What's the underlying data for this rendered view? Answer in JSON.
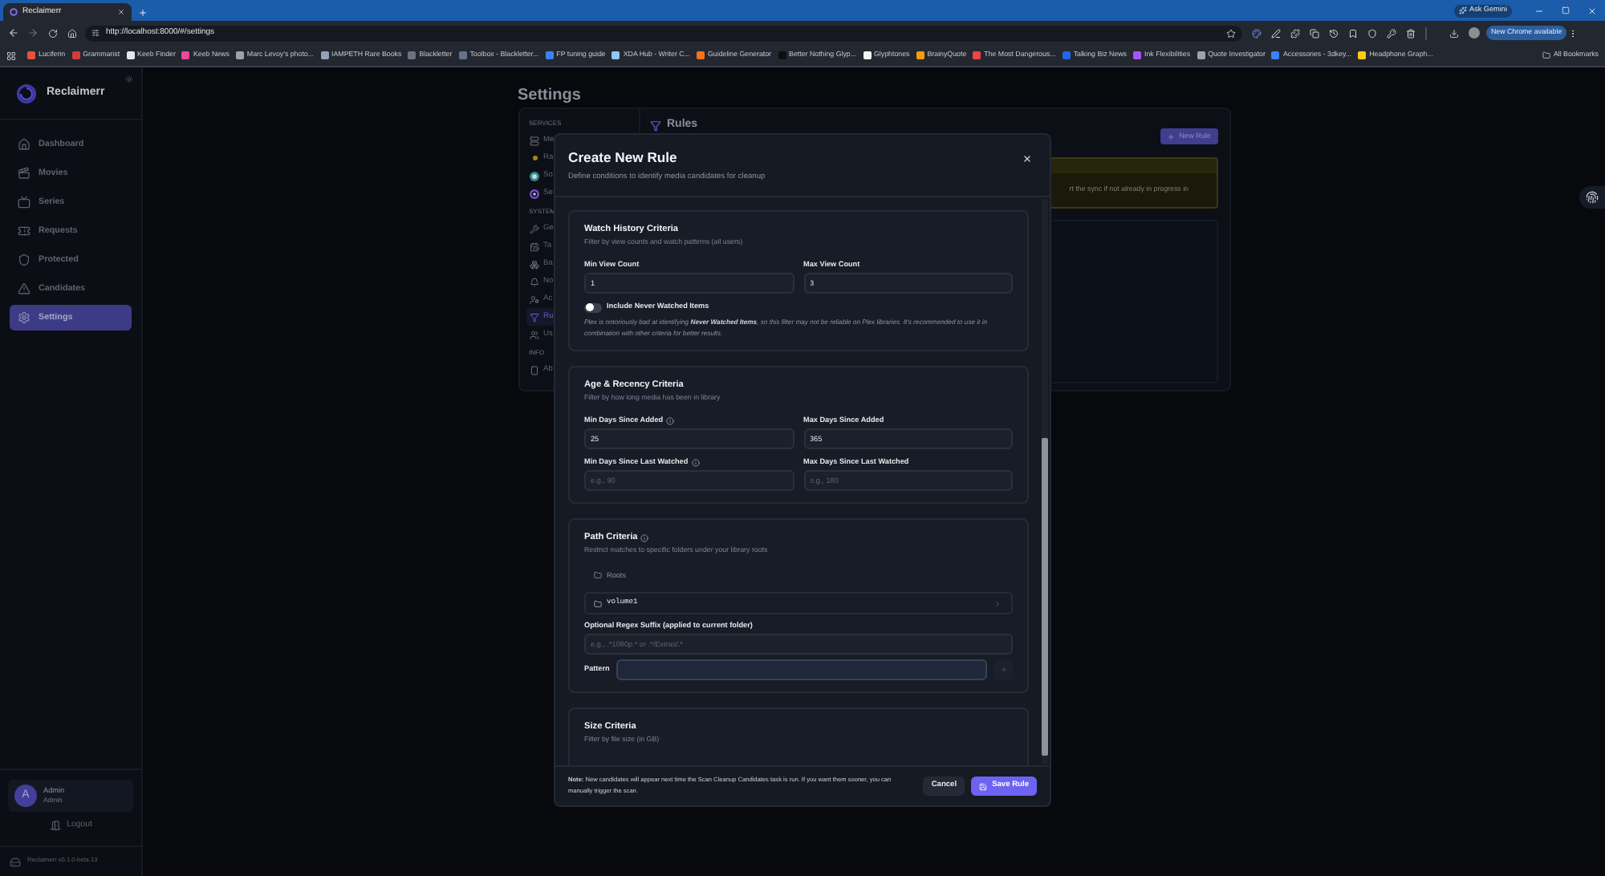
{
  "browser": {
    "tabs": [
      {
        "title": "Reclaimerr",
        "selected": true
      }
    ],
    "ask_gemini": "Ask Gemini",
    "address": "http://localhost:8000/#/settings",
    "update": "New Chrome available",
    "bookmarks": [
      "Luciferin",
      "Grammarist",
      "Keeb Finder",
      "Keeb News",
      "Marc Levoy's photo...",
      "IAMPETH Rare Books",
      "Blackletter",
      "Toolbox - Blackletter...",
      "FP tuning guide",
      "XDA Hub - Writer C...",
      "Guideline Generator",
      "Better Nothing Glyp...",
      "Glyphtones",
      "BrainyQuote",
      "The Most Dangerous...",
      "Talking Biz News",
      "Ink Flexibilities",
      "Quote Investigator",
      "Accessories - 3dkey...",
      "Headphone Graph..."
    ],
    "all_bookmarks": "All Bookmarks"
  },
  "sidebar": {
    "brand": "Reclaimerr",
    "items": [
      {
        "label": "Dashboard",
        "selected": false
      },
      {
        "label": "Movies",
        "selected": false
      },
      {
        "label": "Series",
        "selected": false
      },
      {
        "label": "Requests",
        "selected": false
      },
      {
        "label": "Protected",
        "selected": false
      },
      {
        "label": "Candidates",
        "selected": false
      },
      {
        "label": "Settings",
        "selected": true
      }
    ],
    "user": {
      "avatar": "A",
      "name": "Admin",
      "role": "Admin"
    },
    "logout": "Logout",
    "version": "Reclaimerr v0.1.0-beta.13"
  },
  "settings": {
    "title": "Settings",
    "nav": [
      {
        "kind": "heading",
        "label": "SERVICES"
      },
      {
        "kind": "item",
        "label": "Me",
        "selected": false
      },
      {
        "kind": "item",
        "label": "Ra",
        "selected": false
      },
      {
        "kind": "item",
        "label": "So",
        "selected": false
      },
      {
        "kind": "item",
        "label": "Se",
        "selected": false
      },
      {
        "kind": "heading",
        "label": "SYSTEM"
      },
      {
        "kind": "item",
        "label": "Ge",
        "selected": false
      },
      {
        "kind": "item",
        "label": "Ta",
        "selected": false
      },
      {
        "kind": "item",
        "label": "Ba",
        "selected": false
      },
      {
        "kind": "item",
        "label": "No",
        "selected": false
      },
      {
        "kind": "item",
        "label": "Ac",
        "selected": false
      },
      {
        "kind": "item",
        "label": "Ru",
        "selected": true
      },
      {
        "kind": "item",
        "label": "Us",
        "selected": false
      },
      {
        "kind": "heading",
        "label": "INFO"
      },
      {
        "kind": "item",
        "label": "Ab",
        "selected": false
      }
    ],
    "panel": {
      "title": "Rules",
      "new_rule": "New Rule",
      "notice": "rt the sync if not already in progress in"
    }
  },
  "modal": {
    "title": "Create New Rule",
    "subtitle": "Define conditions to identify media candidates for cleanup",
    "sections": [
      {
        "title": "Watch History Criteria",
        "info": false,
        "subtitle": "Filter by view counts and watch patterns (all users)",
        "rows": [
          {
            "kind": "fields",
            "fields": [
              {
                "label": "Min View Count",
                "info": false,
                "value": "1"
              },
              {
                "label": "Max View Count",
                "info": false,
                "value": "3"
              }
            ]
          },
          {
            "kind": "toggle",
            "label": "Include Never Watched Items",
            "on": false
          },
          {
            "kind": "note",
            "text": "Plex is notoriously bad at identifying **Never Watched Items**, so this filter may not be reliable on Plex libraries. It's recommended to use it in combination with other criteria for better results."
          }
        ]
      },
      {
        "title": "Age & Recency Criteria",
        "info": false,
        "subtitle": "Filter by how long media has been in library",
        "rows": [
          {
            "kind": "fields",
            "fields": [
              {
                "label": "Min Days Since Added",
                "info": true,
                "value": "25"
              },
              {
                "label": "Max Days Since Added",
                "info": false,
                "value": "365"
              }
            ]
          },
          {
            "kind": "fields",
            "fields": [
              {
                "label": "Min Days Since Last Watched",
                "info": true,
                "placeholder": "e.g., 90"
              },
              {
                "label": "Max Days Since Last Watched",
                "info": false,
                "placeholder": "e.g., 180"
              }
            ]
          }
        ]
      },
      {
        "title": "Path Criteria",
        "info": true,
        "subtitle": "Restrict matches to specific folders under your library roots",
        "rows": [
          {
            "kind": "breadcrumb",
            "label": "Roots"
          },
          {
            "kind": "folder",
            "label": "volume1"
          },
          {
            "kind": "field",
            "label": "Optional Regex Suffix (applied to current folder)",
            "placeholder": "e.g., .*1080p.* or .*/Extras/.*"
          },
          {
            "kind": "pattern",
            "label": "Pattern",
            "add_disabled": true
          }
        ]
      },
      {
        "title": "Size Criteria",
        "info": false,
        "subtitle": "Filter by file size (in GB)"
      }
    ],
    "footer_note": "**Note:** New candidates will appear next time the Scan Cleanup Candidates task is run. If you want them sooner, you can manually trigger the scan.",
    "cancel": "Cancel",
    "save": "Save Rule"
  }
}
